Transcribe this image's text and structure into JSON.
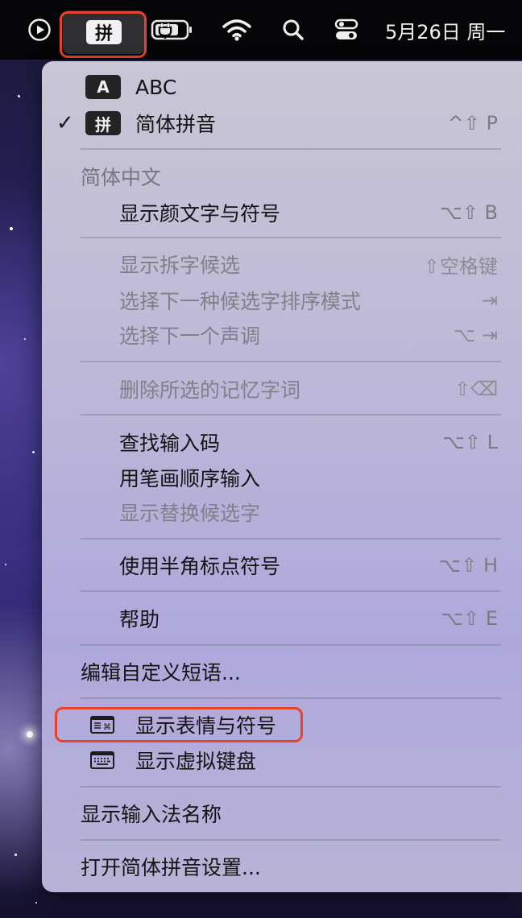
{
  "menubar": {
    "icons": [
      "play-circle-icon",
      "pinyin-input-icon",
      "battery-icon",
      "wifi-icon",
      "search-icon",
      "control-center-icon"
    ],
    "ime_chip": "拼",
    "date_text": "5月26日 周一"
  },
  "input_sources": [
    {
      "badge": "A",
      "label": "ABC",
      "checked": false,
      "shortcut": ""
    },
    {
      "badge": "拼",
      "label": "简体拼音",
      "checked": true,
      "shortcut": "^⇧ P"
    }
  ],
  "section_header": "简体中文",
  "items": {
    "kaomoji": {
      "label": "显示颜文字与符号",
      "shortcut": "⌥⇧ B"
    },
    "split_char": {
      "label": "显示拆字候选",
      "shortcut": "⇧空格键"
    },
    "next_sort": {
      "label": "选择下一种候选字排序模式",
      "shortcut": "⇥"
    },
    "next_tone": {
      "label": "选择下一个声调",
      "shortcut": "⌥ ⇥"
    },
    "delete_memory": {
      "label": "删除所选的记忆字词",
      "shortcut": "⇧⌫"
    },
    "lookup_code": {
      "label": "查找输入码",
      "shortcut": "⌥⇧ L"
    },
    "stroke_input": {
      "label": "用笔画顺序输入",
      "shortcut": ""
    },
    "show_replacement": {
      "label": "显示替换候选字",
      "shortcut": ""
    },
    "halfwidth_punct": {
      "label": "使用半角标点符号",
      "shortcut": "⌥⇧ H"
    },
    "help": {
      "label": "帮助",
      "shortcut": "⌥⇧ E"
    },
    "edit_phrases": {
      "label": "编辑自定义短语...",
      "shortcut": ""
    },
    "emoji_symbols": {
      "label": "显示表情与符号",
      "shortcut": ""
    },
    "virtual_keyboard": {
      "label": "显示虚拟键盘",
      "shortcut": ""
    },
    "show_name": {
      "label": "显示输入法名称",
      "shortcut": ""
    },
    "open_settings": {
      "label": "打开简体拼音设置...",
      "shortcut": ""
    }
  },
  "colors": {
    "highlight": "#e8412c",
    "menubar_bg": "#050507",
    "menu_bg": "#bcb7d8"
  }
}
